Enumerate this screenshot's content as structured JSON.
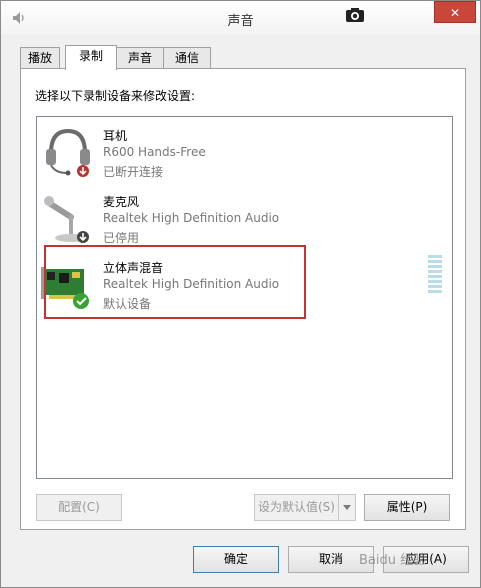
{
  "window": {
    "title": "声音",
    "close_label": "✕",
    "icons": [
      "speaker-app-icon",
      "camera-icon",
      "close-icon"
    ]
  },
  "tabs": [
    {
      "label": "播放",
      "active": false
    },
    {
      "label": "录制",
      "active": true
    },
    {
      "label": "声音",
      "active": false
    },
    {
      "label": "通信",
      "active": false
    }
  ],
  "panel": {
    "instruction": "选择以下录制设备来修改设置:"
  },
  "devices": [
    {
      "name": "耳机",
      "driver": "R600 Hands-Free",
      "status": "已断开连接",
      "icon": "headset-icon",
      "badge": "red-down-arrow-icon"
    },
    {
      "name": "麦克风",
      "driver": "Realtek High Definition Audio",
      "status": "已停用",
      "icon": "microphone-icon",
      "badge": "down-arrow-icon"
    },
    {
      "name": "立体声混音",
      "driver": "Realtek High Definition Audio",
      "status": "默认设备",
      "icon": "sound-card-icon",
      "badge": "green-check-icon",
      "selected": true
    }
  ],
  "buttons": {
    "configure": "配置(C)",
    "set_default": "设为默认值(S)",
    "properties": "属性(P)",
    "ok": "确定",
    "cancel": "取消",
    "apply": "应用(A)"
  },
  "colors": {
    "highlight_border": "#c83233",
    "close_button": "#c8473a",
    "level_meter": "#b9dce6"
  },
  "watermark": "Baidu 经验"
}
